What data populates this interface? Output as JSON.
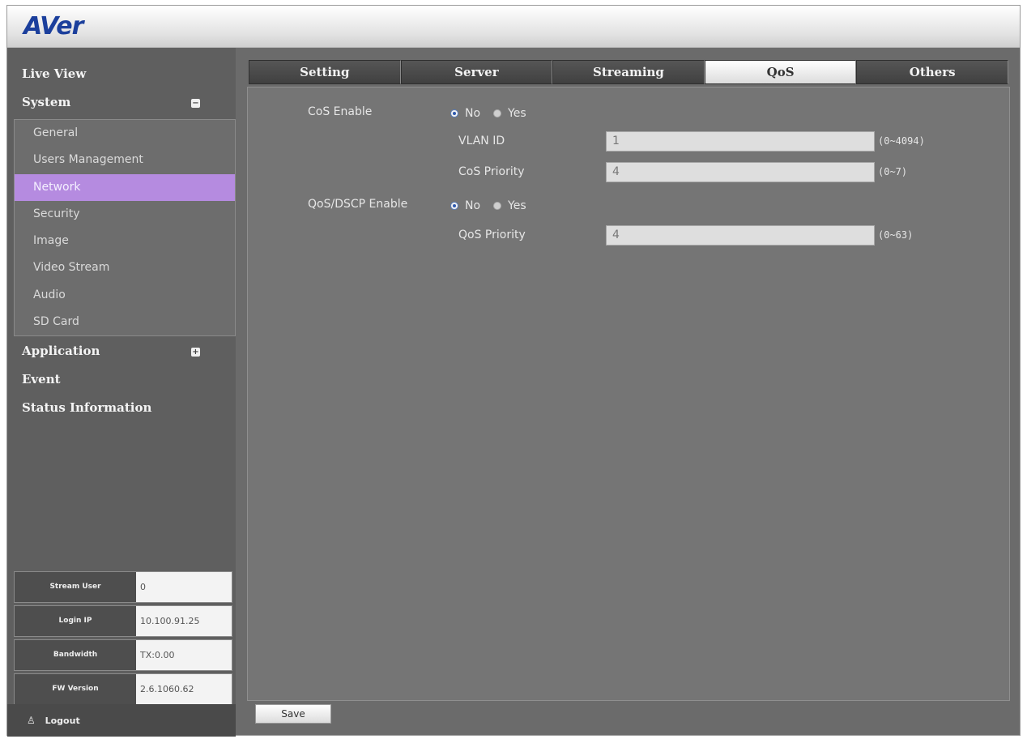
{
  "brand": {
    "logo_text": "AVer"
  },
  "sidebar": {
    "top_items": [
      {
        "label": "Live View"
      },
      {
        "label": "System",
        "toggle": "−"
      },
      {
        "label": "Application",
        "toggle": "+"
      },
      {
        "label": "Event"
      },
      {
        "label": "Status Information"
      }
    ],
    "system_items": [
      {
        "label": "General"
      },
      {
        "label": "Users Management"
      },
      {
        "label": "Network",
        "active": true
      },
      {
        "label": "Security"
      },
      {
        "label": "Image"
      },
      {
        "label": "Video Stream"
      },
      {
        "label": "Audio"
      },
      {
        "label": "SD Card"
      }
    ],
    "info": [
      {
        "key": "Stream User",
        "value": "0"
      },
      {
        "key": "Login IP",
        "value": "10.100.91.25"
      },
      {
        "key": "Bandwidth",
        "value": "TX:0.00"
      },
      {
        "key": "FW Version",
        "value": "2.6.1060.62"
      }
    ],
    "logout_label": "Logout"
  },
  "tabs": [
    {
      "label": "Setting"
    },
    {
      "label": "Server"
    },
    {
      "label": "Streaming"
    },
    {
      "label": "QoS",
      "active": true
    },
    {
      "label": "Others"
    }
  ],
  "qos": {
    "cos_enable_label": "CoS Enable",
    "cos_enable": {
      "no_label": "No",
      "yes_label": "Yes",
      "selected": "No"
    },
    "vlan_id_label": "VLAN ID",
    "vlan_id_value": "1",
    "vlan_id_range": "(0~4094)",
    "cos_priority_label": "CoS Priority",
    "cos_priority_value": "4",
    "cos_priority_range": "(0~7)",
    "dscp_enable_label": "QoS/DSCP Enable",
    "dscp_enable": {
      "no_label": "No",
      "yes_label": "Yes",
      "selected": "No"
    },
    "qos_priority_label": "QoS Priority",
    "qos_priority_value": "4",
    "qos_priority_range": "(0~63)"
  },
  "save_label": "Save",
  "colors": {
    "active_nav": "#b58be0",
    "brand": "#1b3f9c",
    "panel": "#757575"
  }
}
